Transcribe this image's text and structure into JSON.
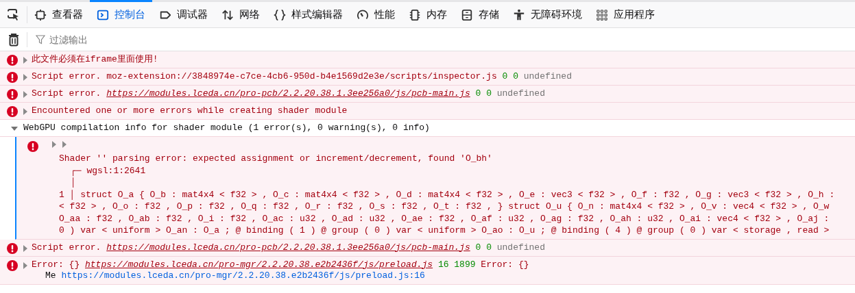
{
  "toolbar": {
    "tabs": [
      {
        "label": "查看器",
        "selected": false
      },
      {
        "label": "控制台",
        "selected": true
      },
      {
        "label": "调试器",
        "selected": false
      },
      {
        "label": "网络",
        "selected": false
      },
      {
        "label": "样式编辑器",
        "selected": false
      },
      {
        "label": "性能",
        "selected": false
      },
      {
        "label": "内存",
        "selected": false
      },
      {
        "label": "存储",
        "selected": false
      },
      {
        "label": "无障碍环境",
        "selected": false
      },
      {
        "label": "应用程序",
        "selected": false
      }
    ]
  },
  "filter": {
    "placeholder": "过滤输出"
  },
  "messages": [
    {
      "kind": "error",
      "expanded": false,
      "parts": [
        {
          "kind": "text",
          "text": "此文件必须在iframe里面使用!"
        }
      ]
    },
    {
      "kind": "error",
      "expanded": false,
      "parts": [
        {
          "kind": "text",
          "text": "Script error. moz-extension://3848974e-c7ce-4cb6-950d-b4e1569d2e3e/scripts/inspector.js"
        },
        {
          "kind": "number",
          "text": "0"
        },
        {
          "kind": "number",
          "text": "0"
        },
        {
          "kind": "muted",
          "text": "undefined"
        }
      ]
    },
    {
      "kind": "error",
      "expanded": false,
      "parts": [
        {
          "kind": "text",
          "text": "Script error."
        },
        {
          "kind": "link",
          "text": "https://modules.lceda.cn/pro-pcb/2.2.20.38.1.3ee256a0/js/pcb-main.js"
        },
        {
          "kind": "number",
          "text": "0"
        },
        {
          "kind": "number",
          "text": "0"
        },
        {
          "kind": "muted",
          "text": "undefined"
        }
      ]
    },
    {
      "kind": "error",
      "expanded": false,
      "parts": [
        {
          "kind": "text",
          "text": "Encountered one or more errors while creating shader module"
        }
      ]
    },
    {
      "kind": "group",
      "expanded": true,
      "parts": [
        {
          "kind": "plain",
          "text": "WebGPU compilation info for shader module (1 error(s), 0 warning(s), 0 info)"
        }
      ],
      "children": [
        {
          "kind": "error",
          "expanded": false,
          "lines": [
            {
              "kind": "plain",
              "text": "Shader '' parsing error: expected assignment or increment/decrement, found 'O_bh'"
            },
            {
              "kind": "indent",
              "text": "┌─ wgsl:1:2641"
            },
            {
              "kind": "indent",
              "text": "│"
            },
            {
              "kind": "plain",
              "text": "1 │ struct O_a { O_b : mat4x4 < f32 > , O_c : mat4x4 < f32 > , O_d : mat4x4 < f32 > , O_e : vec3 < f32 > , O_f : f32 , O_g : vec3 < f32 > , O_h :"
            },
            {
              "kind": "plain",
              "text": "< f32 > , O_o : f32 , O_p : f32 , O_q : f32 , O_r : f32 , O_s : f32 , O_t : f32 , } struct O_u { O_n : mat4x4 < f32 > , O_v : vec4 < f32 > , O_w"
            },
            {
              "kind": "plain",
              "text": "O_aa : f32 , O_ab : f32 , O_i : f32 , O_ac : u32 , O_ad : u32 , O_ae : f32 , O_af : u32 , O_ag : f32 , O_ah : u32 , O_ai : vec4 < f32 > , O_aj :"
            },
            {
              "kind": "plain",
              "text": "0 ) var < uniform > O_an : O_a ; @ binding ( 1 ) @ group ( 0 ) var < uniform > O_ao : O_u ; @ binding ( 4 ) @ group ( 0 ) var < storage , read >"
            }
          ]
        }
      ]
    },
    {
      "kind": "error",
      "expanded": false,
      "parts": [
        {
          "kind": "text",
          "text": "Script error."
        },
        {
          "kind": "link",
          "text": "https://modules.lceda.cn/pro-pcb/2.2.20.38.1.3ee256a0/js/pcb-main.js"
        },
        {
          "kind": "number",
          "text": "0"
        },
        {
          "kind": "number",
          "text": "0"
        },
        {
          "kind": "muted",
          "text": "undefined"
        }
      ]
    },
    {
      "kind": "error",
      "expanded": false,
      "parts": [
        {
          "kind": "text",
          "text": "Error: {}"
        },
        {
          "kind": "link",
          "text": "https://modules.lceda.cn/pro-mgr/2.2.20.38.e2b2436f/js/preload.js"
        },
        {
          "kind": "number",
          "text": "16"
        },
        {
          "kind": "number",
          "text": "1899"
        },
        {
          "kind": "text",
          "text": "Error: {}"
        }
      ],
      "stack": [
        {
          "name": "Me",
          "location": "https://modules.lceda.cn/pro-mgr/2.2.20.38.e2b2436f/js/preload.js:16"
        }
      ]
    }
  ]
}
